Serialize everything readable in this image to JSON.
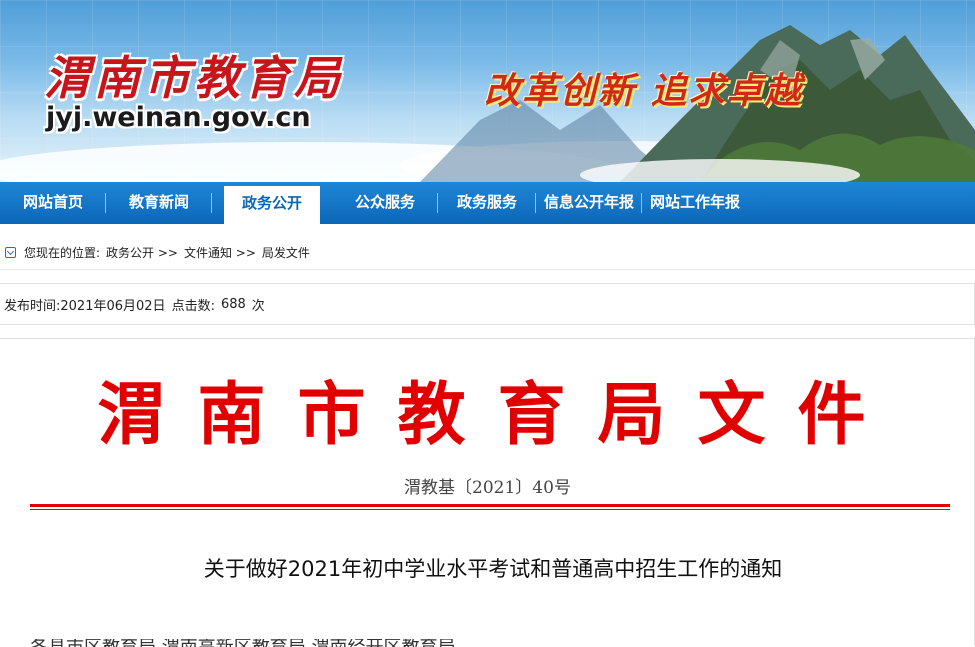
{
  "banner": {
    "site_title": "渭南市教育局",
    "site_domain": "jyj.weinan.gov.cn",
    "slogan": "改革创新 追求卓越",
    "icon": "mountain-scene-image"
  },
  "nav": {
    "items": [
      {
        "label": "网站首页"
      },
      {
        "label": "教育新闻"
      },
      {
        "label": "政务公开",
        "active": true
      },
      {
        "label": "公众服务"
      },
      {
        "label": "政务服务"
      },
      {
        "label": "信息公开年报"
      },
      {
        "label": "网站工作年报"
      }
    ]
  },
  "breadcrumb": {
    "prefix": "您现在的位置:",
    "items": [
      "政务公开 >>",
      "文件通知 >>",
      "局发文件"
    ]
  },
  "meta": {
    "publish_label": "发布时间:",
    "publish_date": "2021年06月02日",
    "clicks_label": "点击数:",
    "clicks": "688",
    "clicks_unit": "次"
  },
  "document": {
    "header": "渭南市教育局文件",
    "number": "渭教基〔2021〕40号",
    "title": "关于做好2021年初中学业水平考试和普通高中招生工作的通知",
    "body_start": "各县市区教育局,渭南高新区教育局,渭南经开区教育局"
  },
  "colors": {
    "nav_bg": "#0c66b8",
    "title_red": "#c8151b",
    "doc_red": "#e00000"
  }
}
